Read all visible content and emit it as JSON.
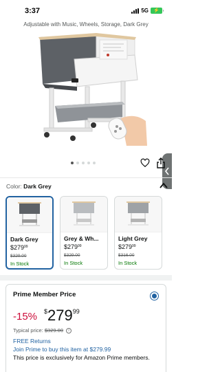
{
  "status_bar": {
    "time": "3:37",
    "network": "5G",
    "battery_color": "#34c759"
  },
  "product": {
    "title_fragment": "Adjustable with Music, Wheels, Storage, Dark Grey"
  },
  "gallery": {
    "image_count": 5,
    "active_index": 0,
    "icons": [
      "heart-icon",
      "share-icon"
    ]
  },
  "variant": {
    "label": "Color:",
    "selected": "Dark Grey",
    "options": [
      {
        "name": "Dark Grey",
        "price_dollars": "$279",
        "price_cents": "99",
        "list_price": "$329.00",
        "stock": "In Stock",
        "selected": true
      },
      {
        "name": "Grey & Wh...",
        "price_dollars": "$279",
        "price_cents": "99",
        "list_price": "$329.00",
        "stock": "In Stock",
        "selected": false
      },
      {
        "name": "Light Grey",
        "price_dollars": "$279",
        "price_cents": "99",
        "list_price": "$316.00",
        "stock": "In Stock",
        "selected": false
      }
    ]
  },
  "prime_offer": {
    "title": "Prime Member Price",
    "discount": "-15%",
    "currency": "$",
    "price_whole": "279",
    "price_cents": "99",
    "typical_label": "Typical price:",
    "typical_price": "$329.00",
    "free_returns": "FREE Returns",
    "join_text": "Join Prime to buy this item at $279.99",
    "exclusive_text": "This price is exclusively for Amazon Prime members."
  },
  "colors": {
    "link": "#2162a1",
    "deal_red": "#cc0c39",
    "in_stock_green": "#007600"
  }
}
